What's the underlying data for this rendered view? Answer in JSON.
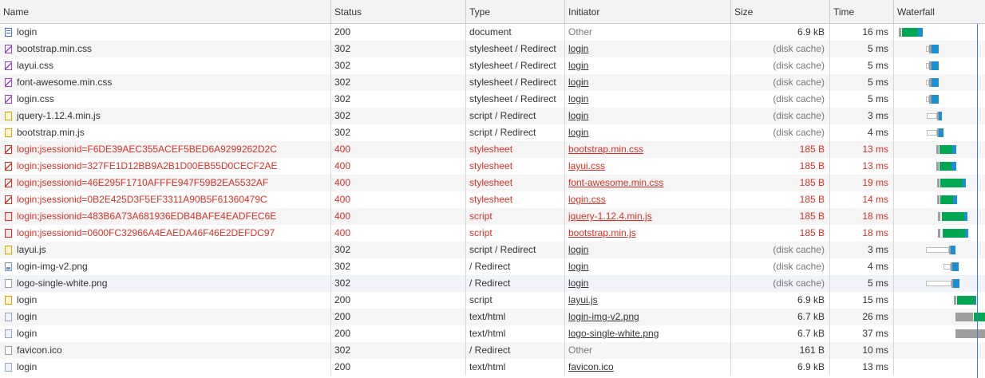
{
  "columns": {
    "name": "Name",
    "status": "Status",
    "type": "Type",
    "initiator": "Initiator",
    "size": "Size",
    "time": "Time",
    "waterfall": "Waterfall"
  },
  "colors": {
    "error": "#d93025",
    "waiting": "#00a651",
    "download": "#1a8fd6",
    "queue": "#9e9e9e",
    "marker": "#3a7bd5"
  },
  "requests": [
    {
      "name": "login",
      "status": "200",
      "type": "document",
      "initiator": "Other",
      "size": "6.9 kB",
      "time": "16 ms",
      "icon": "document-icon"
    },
    {
      "name": "bootstrap.min.css",
      "status": "302",
      "type": "stylesheet / Redirect",
      "initiator": "login",
      "size": "(disk cache)",
      "time": "5 ms",
      "icon": "stylesheet-icon"
    },
    {
      "name": "layui.css",
      "status": "302",
      "type": "stylesheet / Redirect",
      "initiator": "login",
      "size": "(disk cache)",
      "time": "5 ms",
      "icon": "stylesheet-icon"
    },
    {
      "name": "font-awesome.min.css",
      "status": "302",
      "type": "stylesheet / Redirect",
      "initiator": "login",
      "size": "(disk cache)",
      "time": "5 ms",
      "icon": "stylesheet-icon"
    },
    {
      "name": "login.css",
      "status": "302",
      "type": "stylesheet / Redirect",
      "initiator": "login",
      "size": "(disk cache)",
      "time": "5 ms",
      "icon": "stylesheet-icon"
    },
    {
      "name": "jquery-1.12.4.min.js",
      "status": "302",
      "type": "script / Redirect",
      "initiator": "login",
      "size": "(disk cache)",
      "time": "3 ms",
      "icon": "script-icon"
    },
    {
      "name": "bootstrap.min.js",
      "status": "302",
      "type": "script / Redirect",
      "initiator": "login",
      "size": "(disk cache)",
      "time": "4 ms",
      "icon": "script-icon"
    },
    {
      "name": "login;jsessionid=F6DE39AEC355ACEF5BED6A9299262D2C",
      "status": "400",
      "type": "stylesheet",
      "initiator": "bootstrap.min.css",
      "size": "185 B",
      "time": "13 ms",
      "icon": "error-stylesheet-icon"
    },
    {
      "name": "login;jsessionid=327FE1D12BB9A2B1D00EB55D0CECF2AE",
      "status": "400",
      "type": "stylesheet",
      "initiator": "layui.css",
      "size": "185 B",
      "time": "13 ms",
      "icon": "error-stylesheet-icon"
    },
    {
      "name": "login;jsessionid=46E295F1710AFFFE947F59B2EA5532AF",
      "status": "400",
      "type": "stylesheet",
      "initiator": "font-awesome.min.css",
      "size": "185 B",
      "time": "19 ms",
      "icon": "error-stylesheet-icon"
    },
    {
      "name": "login;jsessionid=0B2E425D3F5EF3311A90B5F61360479C",
      "status": "400",
      "type": "stylesheet",
      "initiator": "login.css",
      "size": "185 B",
      "time": "14 ms",
      "icon": "error-stylesheet-icon"
    },
    {
      "name": "login;jsessionid=483B6A73A681936EDB4BAFE4EADFEC6E",
      "status": "400",
      "type": "script",
      "initiator": "jquery-1.12.4.min.js",
      "size": "185 B",
      "time": "18 ms",
      "icon": "error-script-icon"
    },
    {
      "name": "login;jsessionid=0600FC32966A4EAEDA46F46E2DEFDC97",
      "status": "400",
      "type": "script",
      "initiator": "bootstrap.min.js",
      "size": "185 B",
      "time": "18 ms",
      "icon": "error-script-icon"
    },
    {
      "name": "layui.js",
      "status": "302",
      "type": "script / Redirect",
      "initiator": "login",
      "size": "(disk cache)",
      "time": "3 ms",
      "icon": "script-icon"
    },
    {
      "name": "login-img-v2.png",
      "status": "302",
      "type": "/ Redirect",
      "initiator": "login",
      "size": "(disk cache)",
      "time": "4 ms",
      "icon": "image-icon"
    },
    {
      "name": "logo-single-white.png",
      "status": "302",
      "type": "/ Redirect",
      "initiator": "login",
      "size": "(disk cache)",
      "time": "5 ms",
      "icon": "blank-file-icon"
    },
    {
      "name": "login",
      "status": "200",
      "type": "script",
      "initiator": "layui.js",
      "size": "6.9 kB",
      "time": "15 ms",
      "icon": "script-icon"
    },
    {
      "name": "login",
      "status": "200",
      "type": "text/html",
      "initiator": "login-img-v2.png",
      "size": "6.7 kB",
      "time": "26 ms",
      "icon": "html-icon"
    },
    {
      "name": "login",
      "status": "200",
      "type": "text/html",
      "initiator": "logo-single-white.png",
      "size": "6.7 kB",
      "time": "37 ms",
      "icon": "html-icon"
    },
    {
      "name": "favicon.ico",
      "status": "302",
      "type": "/ Redirect",
      "initiator": "Other",
      "size": "161 B",
      "time": "10 ms",
      "icon": "blank-file-icon"
    },
    {
      "name": "login",
      "status": "200",
      "type": "text/html",
      "initiator": "favicon.ico",
      "size": "6.9 kB",
      "time": "13 ms",
      "icon": "html-icon"
    }
  ]
}
